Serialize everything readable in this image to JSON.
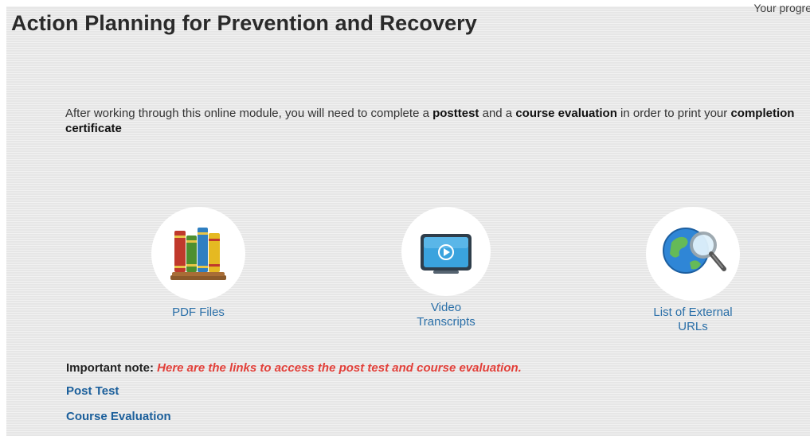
{
  "header": {
    "title": "Action Planning for Prevention and Recovery",
    "progress_partial": "Your progre"
  },
  "intro": {
    "part1": "After working through this online module, you will need to complete a ",
    "posttest": "posttest",
    "part2": " and a ",
    "course_evaluation": "course evaluation",
    "part3": " in order to print your ",
    "certificate": "completion certificate"
  },
  "resources": [
    {
      "label": "PDF Files",
      "icon": "books-icon"
    },
    {
      "label_line1": "Video",
      "label_line2": "Transcripts",
      "icon": "video-screen-icon"
    },
    {
      "label_line1": "List of External",
      "label_line2": "URLs",
      "icon": "globe-magnifier-icon"
    }
  ],
  "note": {
    "label": "Important note: ",
    "text": "Here are the links to access the post test and course evaluation."
  },
  "links": {
    "post_test": "Post Test",
    "course_evaluation": "Course Evaluation"
  },
  "colors": {
    "link": "#1b5f9b",
    "resource_link": "#2a6fa8",
    "note_red": "#e2403a",
    "panel_bg": "#eaeaea"
  }
}
